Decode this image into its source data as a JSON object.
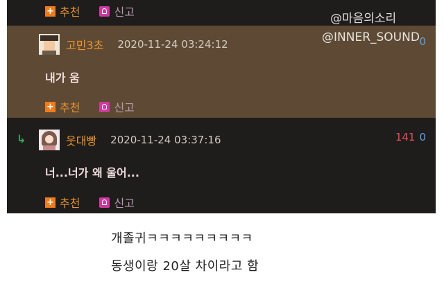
{
  "watermark": {
    "line1": "@마음의소리",
    "line2": "@INNER_SOUND"
  },
  "actions": {
    "recommend": "추천",
    "report": "신고"
  },
  "comments": [
    {
      "nick": "고민3초",
      "date": "2020-11-24 03:24:12",
      "body": "내가 움",
      "count_red": "",
      "count_blue": "0"
    },
    {
      "nick": "웃대빵",
      "date": "2020-11-24 03:37:16",
      "body": "너...너가 왜 울어...",
      "count_red": "141",
      "count_blue": "0"
    }
  ],
  "captions": {
    "line1": "개졸귀ㅋㅋㅋㅋㅋㅋㅋㅋㅋ",
    "line2": "동생이랑 20살 차이라고 함"
  },
  "colors": {
    "highlight": "#5e4a34",
    "dark_bg": "#1e1d1c",
    "nick": "#f0962a"
  }
}
